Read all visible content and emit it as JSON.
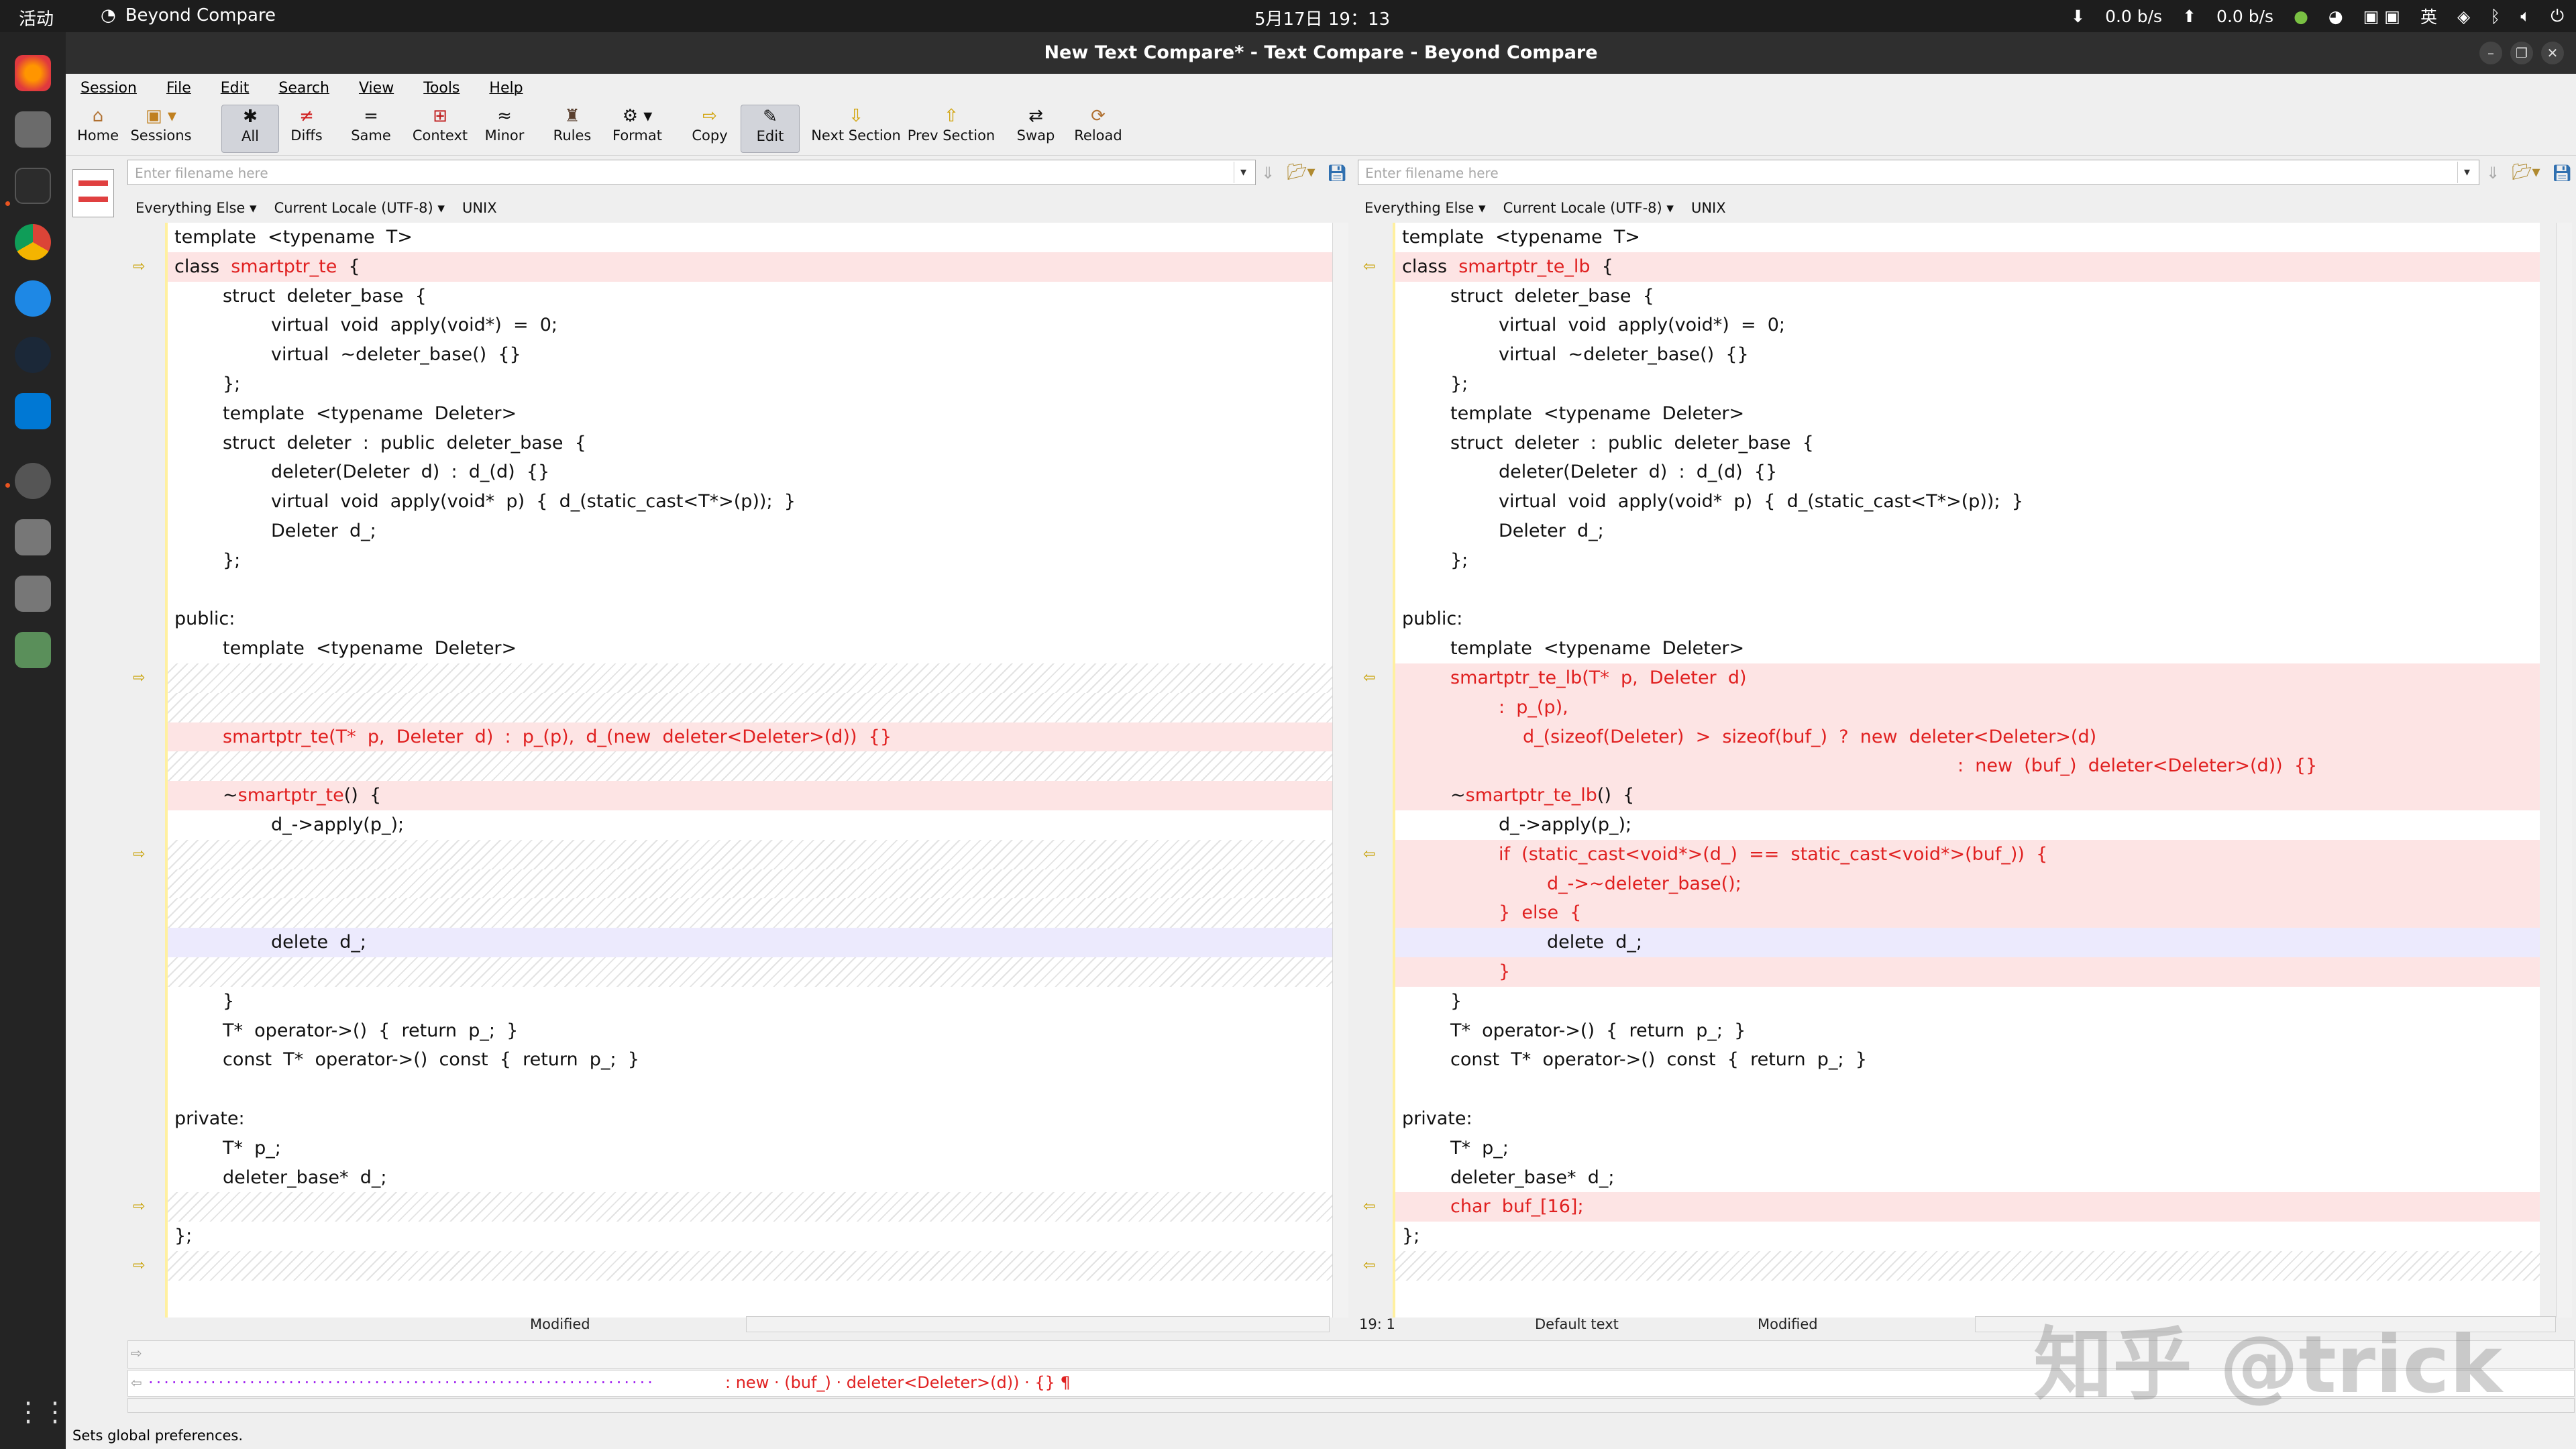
{
  "topbar": {
    "activities": "活动",
    "app_name": "Beyond Compare",
    "clock": "5月17日 19：13",
    "net_down": "0.0  b/s",
    "net_up": "0.0  b/s",
    "ime": "英"
  },
  "window": {
    "title": "New Text Compare* - Text Compare - Beyond Compare"
  },
  "menu": [
    "Session",
    "File",
    "Edit",
    "Search",
    "View",
    "Tools",
    "Help"
  ],
  "toolbar": {
    "home": "Home",
    "sessions": "Sessions",
    "all": "All",
    "diffs": "Diffs",
    "same": "Same",
    "context": "Context",
    "minor": "Minor",
    "rules": "Rules",
    "format": "Format",
    "copy": "Copy",
    "edit": "Edit",
    "next_section": "Next Section",
    "prev_section": "Prev Section",
    "swap": "Swap",
    "reload": "Reload"
  },
  "left": {
    "filename_placeholder": "Enter filename here",
    "filter": "Everything Else",
    "encoding": "Current Locale (UTF-8)",
    "line_endings": "UNIX",
    "status": "Modified",
    "lines": [
      {
        "t": "template  <typename  T>",
        "k": "n",
        "i": 0
      },
      {
        "t": "class  smartptr_te  {",
        "k": "d",
        "i": 0
      },
      {
        "t": "struct  deleter_base  {",
        "k": "n",
        "i": 1
      },
      {
        "t": "virtual  void  apply(void*)  =  0;",
        "k": "n",
        "i": 2
      },
      {
        "t": "virtual  ~deleter_base()  {}",
        "k": "n",
        "i": 2
      },
      {
        "t": "};",
        "k": "n",
        "i": 1
      },
      {
        "t": "template  <typename  Deleter>",
        "k": "n",
        "i": 1
      },
      {
        "t": "struct  deleter  :  public  deleter_base  {",
        "k": "n",
        "i": 1
      },
      {
        "t": "deleter(Deleter  d)  :  d_(d)  {}",
        "k": "n",
        "i": 2
      },
      {
        "t": "virtual  void  apply(void*  p)  {  d_(static_cast<T*>(p));  }",
        "k": "n",
        "i": 2
      },
      {
        "t": "Deleter  d_;",
        "k": "n",
        "i": 2
      },
      {
        "t": "};",
        "k": "n",
        "i": 1
      },
      {
        "t": "",
        "k": "n",
        "i": 0
      },
      {
        "t": "public:",
        "k": "n",
        "i": 0
      },
      {
        "t": "template  <typename  Deleter>",
        "k": "n",
        "i": 1
      },
      {
        "t": "",
        "k": "h",
        "i": 0
      },
      {
        "t": "",
        "k": "h",
        "i": 0
      },
      {
        "t": "smartptr_te(T*  p,  Deleter  d)  :  p_(p),  d_(new  deleter<Deleter>(d))  {}",
        "k": "r",
        "i": 1
      },
      {
        "t": "",
        "k": "h",
        "i": 0
      },
      {
        "t": "~smartptr_te()  {",
        "k": "d",
        "i": 1
      },
      {
        "t": "d_->apply(p_);",
        "k": "n",
        "i": 2
      },
      {
        "t": "",
        "k": "h",
        "i": 0
      },
      {
        "t": "",
        "k": "h",
        "i": 0
      },
      {
        "t": "",
        "k": "h",
        "i": 0
      },
      {
        "t": "delete  d_;",
        "k": "b",
        "i": 2
      },
      {
        "t": "",
        "k": "h",
        "i": 0
      },
      {
        "t": "}",
        "k": "n",
        "i": 1
      },
      {
        "t": "T*  operator->()  {  return  p_;  }",
        "k": "n",
        "i": 1
      },
      {
        "t": "const  T*  operator->()  const  {  return  p_;  }",
        "k": "n",
        "i": 1
      },
      {
        "t": "",
        "k": "n",
        "i": 0
      },
      {
        "t": "private:",
        "k": "n",
        "i": 0
      },
      {
        "t": "T*  p_;",
        "k": "n",
        "i": 1
      },
      {
        "t": "deleter_base*  d_;",
        "k": "n",
        "i": 1
      },
      {
        "t": "",
        "k": "h",
        "i": 0
      },
      {
        "t": "};",
        "k": "n",
        "i": 0
      },
      {
        "t": "",
        "k": "h",
        "i": 0
      }
    ]
  },
  "right": {
    "filename_placeholder": "Enter filename here",
    "filter": "Everything Else",
    "encoding": "Current Locale (UTF-8)",
    "line_endings": "UNIX",
    "position": "19: 1",
    "text_format": "Default text",
    "status": "Modified",
    "lines": [
      {
        "t": "template  <typename  T>",
        "k": "n",
        "i": 0
      },
      {
        "t": "class  smartptr_te_lb  {",
        "k": "d",
        "i": 0
      },
      {
        "t": "struct  deleter_base  {",
        "k": "n",
        "i": 1
      },
      {
        "t": "virtual  void  apply(void*)  =  0;",
        "k": "n",
        "i": 2
      },
      {
        "t": "virtual  ~deleter_base()  {}",
        "k": "n",
        "i": 2
      },
      {
        "t": "};",
        "k": "n",
        "i": 1
      },
      {
        "t": "template  <typename  Deleter>",
        "k": "n",
        "i": 1
      },
      {
        "t": "struct  deleter  :  public  deleter_base  {",
        "k": "n",
        "i": 1
      },
      {
        "t": "deleter(Deleter  d)  :  d_(d)  {}",
        "k": "n",
        "i": 2
      },
      {
        "t": "virtual  void  apply(void*  p)  {  d_(static_cast<T*>(p));  }",
        "k": "n",
        "i": 2
      },
      {
        "t": "Deleter  d_;",
        "k": "n",
        "i": 2
      },
      {
        "t": "};",
        "k": "n",
        "i": 1
      },
      {
        "t": "",
        "k": "n",
        "i": 0
      },
      {
        "t": "public:",
        "k": "n",
        "i": 0
      },
      {
        "t": "template  <typename  Deleter>",
        "k": "n",
        "i": 1
      },
      {
        "t": "smartptr_te_lb(T*  p,  Deleter  d)",
        "k": "r",
        "i": 1
      },
      {
        "t": ":  p_(p),",
        "k": "r",
        "i": 2
      },
      {
        "t": "d_(sizeof(Deleter)  >  sizeof(buf_)  ?  new  deleter<Deleter>(d)",
        "k": "r",
        "i": 2.5
      },
      {
        "t": ":  new  (buf_)  deleter<Deleter>(d))  {}",
        "k": "r",
        "i": 11.5
      },
      {
        "t": "~smartptr_te_lb()  {",
        "k": "d",
        "i": 1
      },
      {
        "t": "d_->apply(p_);",
        "k": "n",
        "i": 2
      },
      {
        "t": "if  (static_cast<void*>(d_)  ==  static_cast<void*>(buf_))  {",
        "k": "r",
        "i": 2
      },
      {
        "t": "d_->~deleter_base();",
        "k": "r",
        "i": 3
      },
      {
        "t": "}  else  {",
        "k": "r",
        "i": 2
      },
      {
        "t": "delete  d_;",
        "k": "b",
        "i": 3
      },
      {
        "t": "}",
        "k": "r",
        "i": 2
      },
      {
        "t": "}",
        "k": "n",
        "i": 1
      },
      {
        "t": "T*  operator->()  {  return  p_;  }",
        "k": "n",
        "i": 1
      },
      {
        "t": "const  T*  operator->()  const  {  return  p_;  }",
        "k": "n",
        "i": 1
      },
      {
        "t": "",
        "k": "n",
        "i": 0
      },
      {
        "t": "private:",
        "k": "n",
        "i": 0
      },
      {
        "t": "T*  p_;",
        "k": "n",
        "i": 1
      },
      {
        "t": "deleter_base*  d_;",
        "k": "n",
        "i": 1
      },
      {
        "t": "char  buf_[16];",
        "k": "r",
        "i": 1
      },
      {
        "t": "};",
        "k": "n",
        "i": 0
      },
      {
        "t": "",
        "k": "h",
        "i": 0
      }
    ]
  },
  "bottom_line": ": new · (buf_) · deleter<Deleter>(d)) · {} ¶",
  "statusbar": "Sets global preferences.",
  "watermark": "知乎 @trick",
  "colors": {
    "diff_bg": "#fde4e4",
    "diff_text": "#e02020",
    "minor_bg": "#eceafd"
  }
}
